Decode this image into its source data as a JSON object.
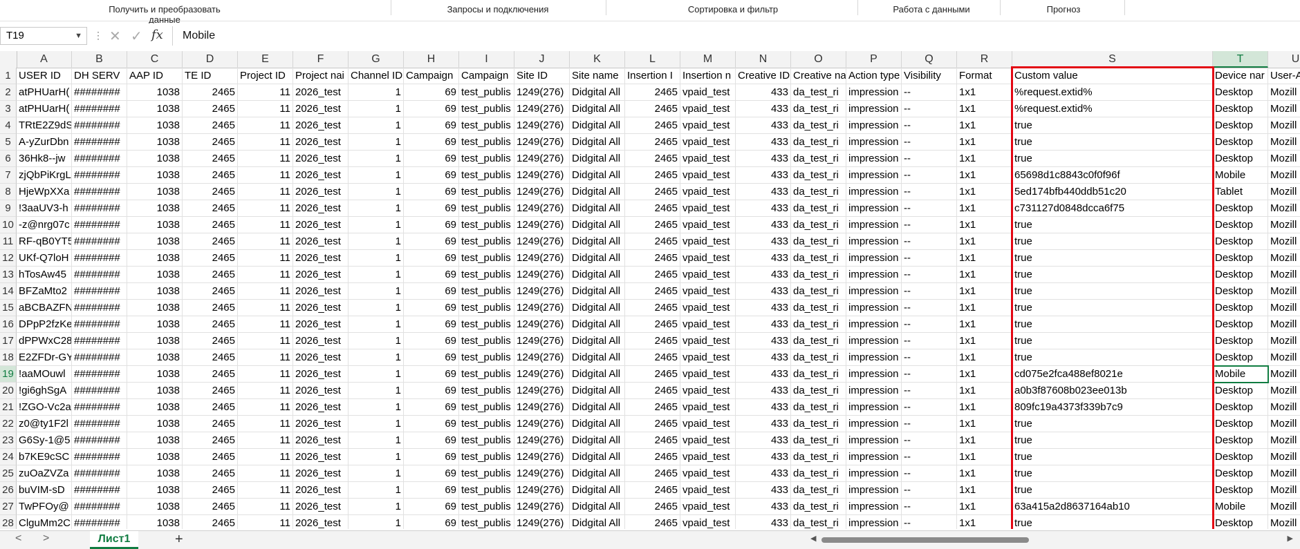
{
  "ribbon": {
    "groups": [
      "Получить и преобразовать данные",
      "Запросы и подключения",
      "Сортировка и фильтр",
      "Работа с данными",
      "Прогноз"
    ]
  },
  "formula_bar": {
    "name_box": "T19",
    "cancel_glyph": "✕",
    "enter_glyph": "✓",
    "fx_label": "fx",
    "value": "Mobile"
  },
  "columns": [
    "A",
    "B",
    "C",
    "D",
    "E",
    "F",
    "G",
    "H",
    "I",
    "J",
    "K",
    "L",
    "M",
    "N",
    "O",
    "P",
    "Q",
    "R",
    "S",
    "T",
    "U"
  ],
  "headers": [
    "USER ID",
    "DH SERV",
    "AAP ID",
    "TE ID",
    "Project ID",
    "Project nai",
    "Channel ID",
    "Campaign",
    "Campaign",
    "Site ID",
    "Site name",
    "Insertion I",
    "Insertion n",
    "Creative ID",
    "Creative na",
    "Action type",
    "Visibility",
    "Format",
    "Custom value",
    "Device nar",
    "User-A"
  ],
  "row_numbers": [
    "1",
    "2",
    "3",
    "4",
    "5",
    "6",
    "7",
    "8",
    "9",
    "10",
    "11",
    "12",
    "13",
    "14",
    "15",
    "16",
    "17",
    "18",
    "19",
    "20",
    "21",
    "22",
    "23",
    "24",
    "25",
    "26",
    "27",
    "28"
  ],
  "active": {
    "column": "T",
    "row": "19"
  },
  "rows": [
    [
      "atPHUarH(",
      "########",
      "1038",
      "2465",
      "11",
      "2026_test",
      "1",
      "69",
      "test_publis",
      "1249(276)",
      "Didgital All",
      "2465",
      "vpaid_test",
      "433",
      "da_test_ri",
      "impression",
      "--",
      "1x1",
      "%request.extid%",
      "Desktop",
      "Mozill"
    ],
    [
      "atPHUarH(",
      "########",
      "1038",
      "2465",
      "11",
      "2026_test",
      "1",
      "69",
      "test_publis",
      "1249(276)",
      "Didgital All",
      "2465",
      "vpaid_test",
      "433",
      "da_test_ri",
      "impression",
      "--",
      "1x1",
      "%request.extid%",
      "Desktop",
      "Mozill"
    ],
    [
      "TRtE2Z9dS",
      "########",
      "1038",
      "2465",
      "11",
      "2026_test",
      "1",
      "69",
      "test_publis",
      "1249(276)",
      "Didgital All",
      "2465",
      "vpaid_test",
      "433",
      "da_test_ri",
      "impression",
      "--",
      "1x1",
      "true",
      "Desktop",
      "Mozill"
    ],
    [
      "A-yZurDbn",
      "########",
      "1038",
      "2465",
      "11",
      "2026_test",
      "1",
      "69",
      "test_publis",
      "1249(276)",
      "Didgital All",
      "2465",
      "vpaid_test",
      "433",
      "da_test_ri",
      "impression",
      "--",
      "1x1",
      "true",
      "Desktop",
      "Mozill"
    ],
    [
      "36Hk8--jw",
      "########",
      "1038",
      "2465",
      "11",
      "2026_test",
      "1",
      "69",
      "test_publis",
      "1249(276)",
      "Didgital All",
      "2465",
      "vpaid_test",
      "433",
      "da_test_ri",
      "impression",
      "--",
      "1x1",
      "true",
      "Desktop",
      "Mozill"
    ],
    [
      "zjQbPiKrgL",
      "########",
      "1038",
      "2465",
      "11",
      "2026_test",
      "1",
      "69",
      "test_publis",
      "1249(276)",
      "Didgital All",
      "2465",
      "vpaid_test",
      "433",
      "da_test_ri",
      "impression",
      "--",
      "1x1",
      "65698d1c8843c0f0f96f",
      "Mobile",
      "Mozill"
    ],
    [
      "HjeWpXXa",
      "########",
      "1038",
      "2465",
      "11",
      "2026_test",
      "1",
      "69",
      "test_publis",
      "1249(276)",
      "Didgital All",
      "2465",
      "vpaid_test",
      "433",
      "da_test_ri",
      "impression",
      "--",
      "1x1",
      "5ed174bfb440ddb51c20",
      "Tablet",
      "Mozill"
    ],
    [
      "!3aaUV3-h",
      "########",
      "1038",
      "2465",
      "11",
      "2026_test",
      "1",
      "69",
      "test_publis",
      "1249(276)",
      "Didgital All",
      "2465",
      "vpaid_test",
      "433",
      "da_test_ri",
      "impression",
      "--",
      "1x1",
      "c731127d0848dcca6f75",
      "Desktop",
      "Mozill"
    ],
    [
      "-z@nrg07c",
      "########",
      "1038",
      "2465",
      "11",
      "2026_test",
      "1",
      "69",
      "test_publis",
      "1249(276)",
      "Didgital All",
      "2465",
      "vpaid_test",
      "433",
      "da_test_ri",
      "impression",
      "--",
      "1x1",
      "true",
      "Desktop",
      "Mozill"
    ],
    [
      "RF-qB0YT5",
      "########",
      "1038",
      "2465",
      "11",
      "2026_test",
      "1",
      "69",
      "test_publis",
      "1249(276)",
      "Didgital All",
      "2465",
      "vpaid_test",
      "433",
      "da_test_ri",
      "impression",
      "--",
      "1x1",
      "true",
      "Desktop",
      "Mozill"
    ],
    [
      "UKf-Q7loH",
      "########",
      "1038",
      "2465",
      "11",
      "2026_test",
      "1",
      "69",
      "test_publis",
      "1249(276)",
      "Didgital All",
      "2465",
      "vpaid_test",
      "433",
      "da_test_ri",
      "impression",
      "--",
      "1x1",
      "true",
      "Desktop",
      "Mozill"
    ],
    [
      "hTosAw45",
      "########",
      "1038",
      "2465",
      "11",
      "2026_test",
      "1",
      "69",
      "test_publis",
      "1249(276)",
      "Didgital All",
      "2465",
      "vpaid_test",
      "433",
      "da_test_ri",
      "impression",
      "--",
      "1x1",
      "true",
      "Desktop",
      "Mozill"
    ],
    [
      "BFZaMto2",
      "########",
      "1038",
      "2465",
      "11",
      "2026_test",
      "1",
      "69",
      "test_publis",
      "1249(276)",
      "Didgital All",
      "2465",
      "vpaid_test",
      "433",
      "da_test_ri",
      "impression",
      "--",
      "1x1",
      "true",
      "Desktop",
      "Mozill"
    ],
    [
      "aBCBAZFN",
      "########",
      "1038",
      "2465",
      "11",
      "2026_test",
      "1",
      "69",
      "test_publis",
      "1249(276)",
      "Didgital All",
      "2465",
      "vpaid_test",
      "433",
      "da_test_ri",
      "impression",
      "--",
      "1x1",
      "true",
      "Desktop",
      "Mozill"
    ],
    [
      "DPpP2fzKe",
      "########",
      "1038",
      "2465",
      "11",
      "2026_test",
      "1",
      "69",
      "test_publis",
      "1249(276)",
      "Didgital All",
      "2465",
      "vpaid_test",
      "433",
      "da_test_ri",
      "impression",
      "--",
      "1x1",
      "true",
      "Desktop",
      "Mozill"
    ],
    [
      "dPPWxC28",
      "########",
      "1038",
      "2465",
      "11",
      "2026_test",
      "1",
      "69",
      "test_publis",
      "1249(276)",
      "Didgital All",
      "2465",
      "vpaid_test",
      "433",
      "da_test_ri",
      "impression",
      "--",
      "1x1",
      "true",
      "Desktop",
      "Mozill"
    ],
    [
      "E2ZFDr-GY",
      "########",
      "1038",
      "2465",
      "11",
      "2026_test",
      "1",
      "69",
      "test_publis",
      "1249(276)",
      "Didgital All",
      "2465",
      "vpaid_test",
      "433",
      "da_test_ri",
      "impression",
      "--",
      "1x1",
      "true",
      "Desktop",
      "Mozill"
    ],
    [
      "!aaMOuwl",
      "########",
      "1038",
      "2465",
      "11",
      "2026_test",
      "1",
      "69",
      "test_publis",
      "1249(276)",
      "Didgital All",
      "2465",
      "vpaid_test",
      "433",
      "da_test_ri",
      "impression",
      "--",
      "1x1",
      "cd075e2fca488ef8021e",
      "Mobile",
      "Mozill"
    ],
    [
      "!gi6ghSgA",
      "########",
      "1038",
      "2465",
      "11",
      "2026_test",
      "1",
      "69",
      "test_publis",
      "1249(276)",
      "Didgital All",
      "2465",
      "vpaid_test",
      "433",
      "da_test_ri",
      "impression",
      "--",
      "1x1",
      "a0b3f87608b023ee013b",
      "Desktop",
      "Mozill"
    ],
    [
      "!ZGO-Vc2a",
      "########",
      "1038",
      "2465",
      "11",
      "2026_test",
      "1",
      "69",
      "test_publis",
      "1249(276)",
      "Didgital All",
      "2465",
      "vpaid_test",
      "433",
      "da_test_ri",
      "impression",
      "--",
      "1x1",
      "809fc19a4373f339b7c9",
      "Desktop",
      "Mozill"
    ],
    [
      "z0@ty1F2l",
      "########",
      "1038",
      "2465",
      "11",
      "2026_test",
      "1",
      "69",
      "test_publis",
      "1249(276)",
      "Didgital All",
      "2465",
      "vpaid_test",
      "433",
      "da_test_ri",
      "impression",
      "--",
      "1x1",
      "true",
      "Desktop",
      "Mozill"
    ],
    [
      "G6Sy-1@5",
      "########",
      "1038",
      "2465",
      "11",
      "2026_test",
      "1",
      "69",
      "test_publis",
      "1249(276)",
      "Didgital All",
      "2465",
      "vpaid_test",
      "433",
      "da_test_ri",
      "impression",
      "--",
      "1x1",
      "true",
      "Desktop",
      "Mozill"
    ],
    [
      "b7KE9cSC",
      "########",
      "1038",
      "2465",
      "11",
      "2026_test",
      "1",
      "69",
      "test_publis",
      "1249(276)",
      "Didgital All",
      "2465",
      "vpaid_test",
      "433",
      "da_test_ri",
      "impression",
      "--",
      "1x1",
      "true",
      "Desktop",
      "Mozill"
    ],
    [
      "zuOaZVZa",
      "########",
      "1038",
      "2465",
      "11",
      "2026_test",
      "1",
      "69",
      "test_publis",
      "1249(276)",
      "Didgital All",
      "2465",
      "vpaid_test",
      "433",
      "da_test_ri",
      "impression",
      "--",
      "1x1",
      "true",
      "Desktop",
      "Mozill"
    ],
    [
      "buVIM-sD",
      "########",
      "1038",
      "2465",
      "11",
      "2026_test",
      "1",
      "69",
      "test_publis",
      "1249(276)",
      "Didgital All",
      "2465",
      "vpaid_test",
      "433",
      "da_test_ri",
      "impression",
      "--",
      "1x1",
      "true",
      "Desktop",
      "Mozill"
    ],
    [
      "TwPFOy@",
      "########",
      "1038",
      "2465",
      "11",
      "2026_test",
      "1",
      "69",
      "test_publis",
      "1249(276)",
      "Didgital All",
      "2465",
      "vpaid_test",
      "433",
      "da_test_ri",
      "impression",
      "--",
      "1x1",
      "63a415a2d8637164ab10",
      "Mobile",
      "Mozill"
    ],
    [
      "ClguMm2C",
      "########",
      "1038",
      "2465",
      "11",
      "2026_test",
      "1",
      "69",
      "test_publis",
      "1249(276)",
      "Didgital All",
      "2465",
      "vpaid_test",
      "433",
      "da_test_ri",
      "impression",
      "--",
      "1x1",
      "true",
      "Desktop",
      "Mozill"
    ]
  ],
  "numeric_columns": [
    "C",
    "D",
    "E",
    "G",
    "H",
    "L",
    "N"
  ],
  "sheet_tabs": [
    "Лист1"
  ],
  "add_sheet_glyph": "+",
  "nav_prev_glyph": "<",
  "nav_next_glyph": ">",
  "colors": {
    "accent": "#107c41",
    "highlight_border": "#e30613"
  }
}
